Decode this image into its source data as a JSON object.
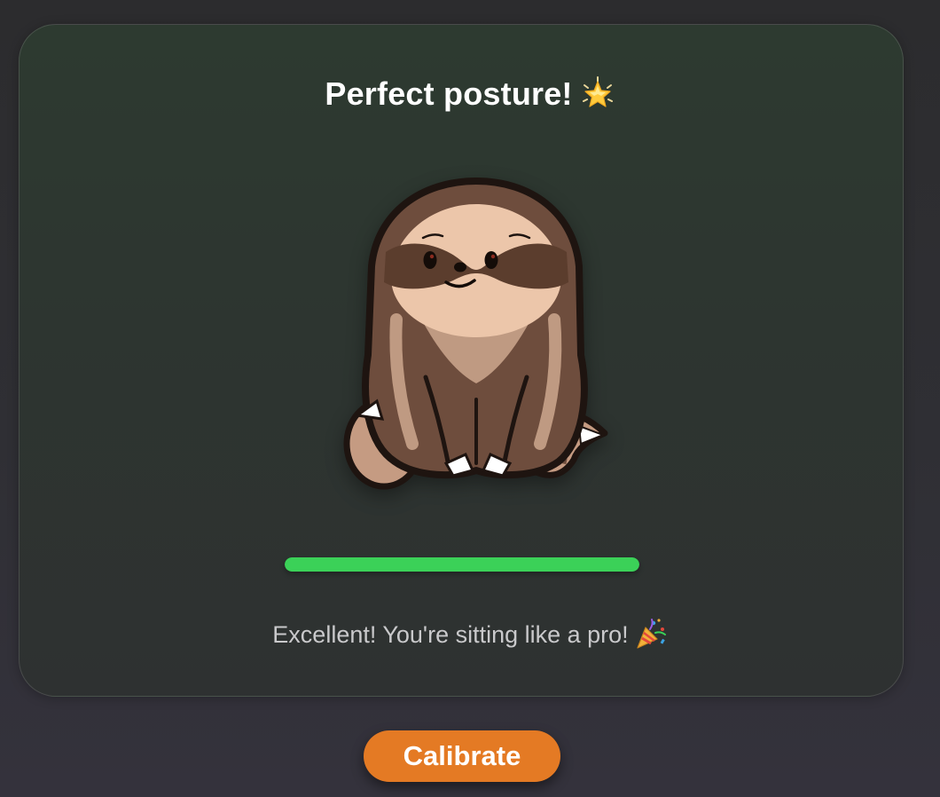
{
  "status": {
    "headline": "Perfect posture!",
    "headline_icon": "glowing-star-emoji",
    "message": "Excellent! You're sitting like a pro!",
    "message_icon": "party-popper-emoji"
  },
  "posture_score": {
    "fraction": 1.0,
    "color": "#3bd158"
  },
  "mascot": {
    "icon": "sloth-mascot",
    "mood": "happy"
  },
  "actions": {
    "calibrate_label": "Calibrate",
    "calibrate_color": "#e47a24"
  }
}
